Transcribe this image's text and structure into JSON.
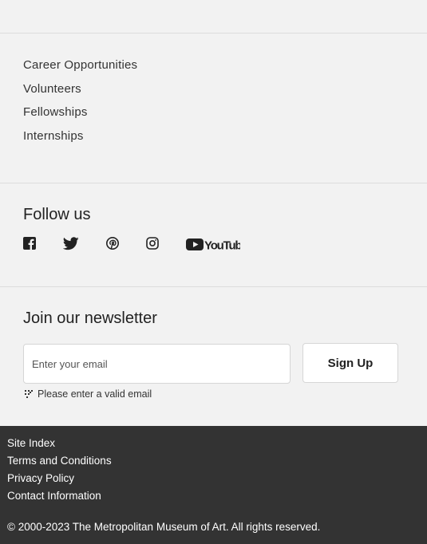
{
  "links": [
    {
      "label": "Career Opportunities"
    },
    {
      "label": "Volunteers"
    },
    {
      "label": "Fellowships"
    },
    {
      "label": "Internships"
    }
  ],
  "follow": {
    "title": "Follow us",
    "icons": [
      "facebook-icon",
      "twitter-icon",
      "pinterest-icon",
      "instagram-icon",
      "youtube-icon"
    ],
    "youtube_text": "YouTube"
  },
  "newsletter": {
    "title": "Join our newsletter",
    "email_placeholder": "Enter your email",
    "email_value": "",
    "signup_label": "Sign Up",
    "error_text": "Please enter a valid email"
  },
  "footer": {
    "links": [
      {
        "label": "Site Index"
      },
      {
        "label": "Terms and Conditions"
      },
      {
        "label": "Privacy Policy"
      },
      {
        "label": "Contact Information"
      }
    ],
    "copyright": "© 2000-2023 The Metropolitan Museum of Art. All rights reserved.",
    "background": "#333333"
  }
}
